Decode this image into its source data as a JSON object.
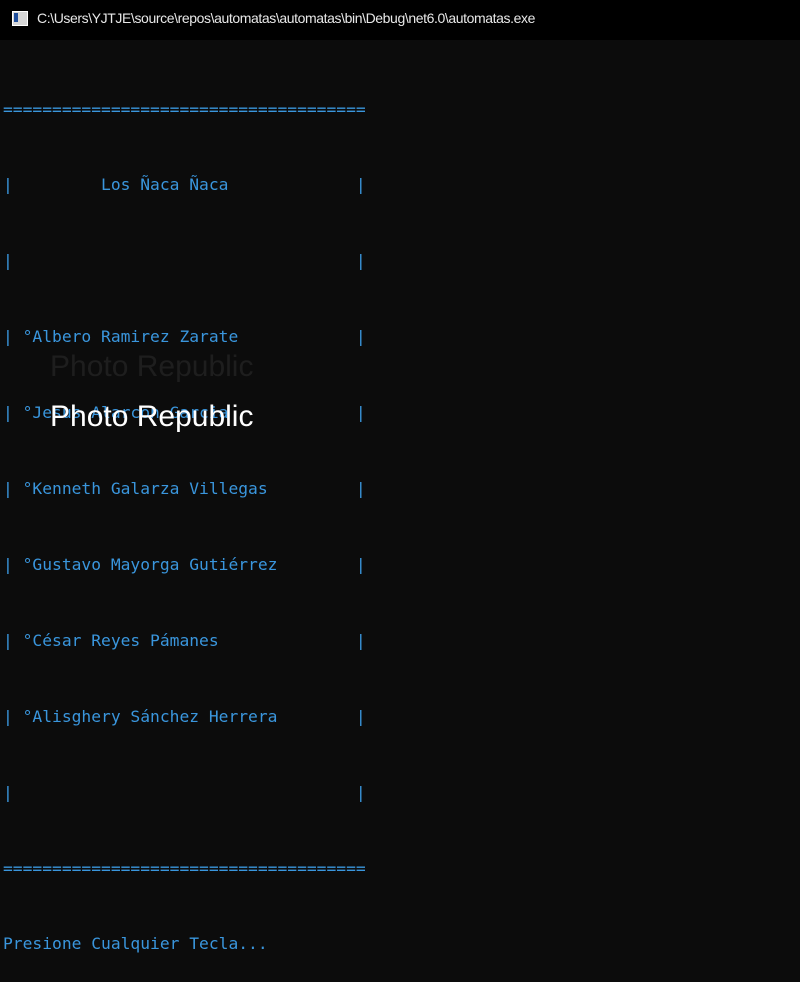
{
  "window": {
    "title": "C:\\Users\\YJTJE\\source\\repos\\automatas\\automatas\\bin\\Debug\\net6.0\\automatas.exe",
    "icon": "console-app-icon"
  },
  "console": {
    "lines": [
      "=====================================",
      "|         Los Ñaca Ñaca             |",
      "|                                   |",
      "| °Albero Ramirez Zarate            |",
      "| °Jesus Alarcon Garcia             |",
      "| °Kenneth Galarza Villegas         |",
      "| °Gustavo Mayorga Gutiérrez        |",
      "| °César Reyes Pámanes              |",
      "| °Alisghery Sánchez Herrera        |",
      "|                                   |",
      "=====================================",
      "Presione Cualquier Tecla..."
    ],
    "text_color": "#3a96dd",
    "background": "#0c0c0c"
  },
  "watermark": {
    "dark_text": "Photo Republic",
    "light_text": "Photo Republic"
  }
}
